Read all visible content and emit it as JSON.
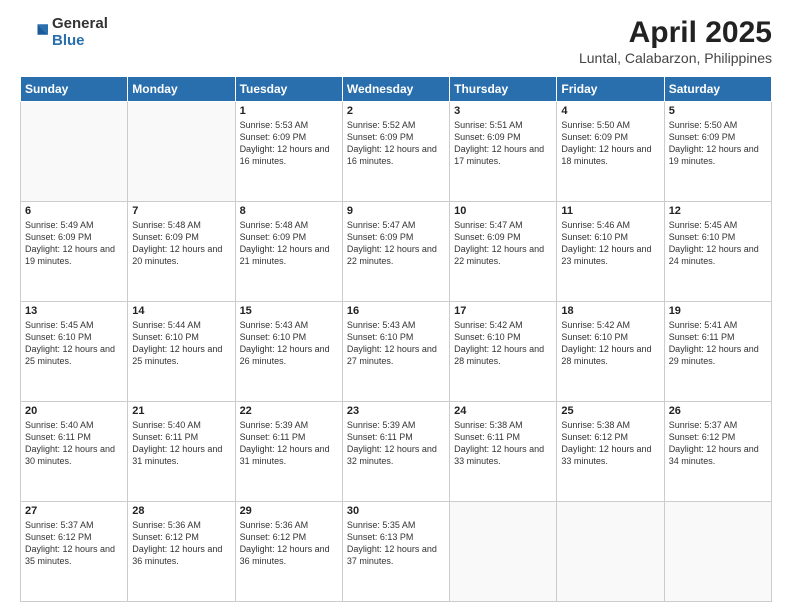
{
  "header": {
    "logo_general": "General",
    "logo_blue": "Blue",
    "month_title": "April 2025",
    "location": "Luntal, Calabarzon, Philippines"
  },
  "weekdays": [
    "Sunday",
    "Monday",
    "Tuesday",
    "Wednesday",
    "Thursday",
    "Friday",
    "Saturday"
  ],
  "weeks": [
    [
      {
        "day": "",
        "sunrise": "",
        "sunset": "",
        "daylight": "",
        "empty": true
      },
      {
        "day": "",
        "sunrise": "",
        "sunset": "",
        "daylight": "",
        "empty": true
      },
      {
        "day": "1",
        "sunrise": "Sunrise: 5:53 AM",
        "sunset": "Sunset: 6:09 PM",
        "daylight": "Daylight: 12 hours and 16 minutes.",
        "empty": false
      },
      {
        "day": "2",
        "sunrise": "Sunrise: 5:52 AM",
        "sunset": "Sunset: 6:09 PM",
        "daylight": "Daylight: 12 hours and 16 minutes.",
        "empty": false
      },
      {
        "day": "3",
        "sunrise": "Sunrise: 5:51 AM",
        "sunset": "Sunset: 6:09 PM",
        "daylight": "Daylight: 12 hours and 17 minutes.",
        "empty": false
      },
      {
        "day": "4",
        "sunrise": "Sunrise: 5:50 AM",
        "sunset": "Sunset: 6:09 PM",
        "daylight": "Daylight: 12 hours and 18 minutes.",
        "empty": false
      },
      {
        "day": "5",
        "sunrise": "Sunrise: 5:50 AM",
        "sunset": "Sunset: 6:09 PM",
        "daylight": "Daylight: 12 hours and 19 minutes.",
        "empty": false
      }
    ],
    [
      {
        "day": "6",
        "sunrise": "Sunrise: 5:49 AM",
        "sunset": "Sunset: 6:09 PM",
        "daylight": "Daylight: 12 hours and 19 minutes.",
        "empty": false
      },
      {
        "day": "7",
        "sunrise": "Sunrise: 5:48 AM",
        "sunset": "Sunset: 6:09 PM",
        "daylight": "Daylight: 12 hours and 20 minutes.",
        "empty": false
      },
      {
        "day": "8",
        "sunrise": "Sunrise: 5:48 AM",
        "sunset": "Sunset: 6:09 PM",
        "daylight": "Daylight: 12 hours and 21 minutes.",
        "empty": false
      },
      {
        "day": "9",
        "sunrise": "Sunrise: 5:47 AM",
        "sunset": "Sunset: 6:09 PM",
        "daylight": "Daylight: 12 hours and 22 minutes.",
        "empty": false
      },
      {
        "day": "10",
        "sunrise": "Sunrise: 5:47 AM",
        "sunset": "Sunset: 6:09 PM",
        "daylight": "Daylight: 12 hours and 22 minutes.",
        "empty": false
      },
      {
        "day": "11",
        "sunrise": "Sunrise: 5:46 AM",
        "sunset": "Sunset: 6:10 PM",
        "daylight": "Daylight: 12 hours and 23 minutes.",
        "empty": false
      },
      {
        "day": "12",
        "sunrise": "Sunrise: 5:45 AM",
        "sunset": "Sunset: 6:10 PM",
        "daylight": "Daylight: 12 hours and 24 minutes.",
        "empty": false
      }
    ],
    [
      {
        "day": "13",
        "sunrise": "Sunrise: 5:45 AM",
        "sunset": "Sunset: 6:10 PM",
        "daylight": "Daylight: 12 hours and 25 minutes.",
        "empty": false
      },
      {
        "day": "14",
        "sunrise": "Sunrise: 5:44 AM",
        "sunset": "Sunset: 6:10 PM",
        "daylight": "Daylight: 12 hours and 25 minutes.",
        "empty": false
      },
      {
        "day": "15",
        "sunrise": "Sunrise: 5:43 AM",
        "sunset": "Sunset: 6:10 PM",
        "daylight": "Daylight: 12 hours and 26 minutes.",
        "empty": false
      },
      {
        "day": "16",
        "sunrise": "Sunrise: 5:43 AM",
        "sunset": "Sunset: 6:10 PM",
        "daylight": "Daylight: 12 hours and 27 minutes.",
        "empty": false
      },
      {
        "day": "17",
        "sunrise": "Sunrise: 5:42 AM",
        "sunset": "Sunset: 6:10 PM",
        "daylight": "Daylight: 12 hours and 28 minutes.",
        "empty": false
      },
      {
        "day": "18",
        "sunrise": "Sunrise: 5:42 AM",
        "sunset": "Sunset: 6:10 PM",
        "daylight": "Daylight: 12 hours and 28 minutes.",
        "empty": false
      },
      {
        "day": "19",
        "sunrise": "Sunrise: 5:41 AM",
        "sunset": "Sunset: 6:11 PM",
        "daylight": "Daylight: 12 hours and 29 minutes.",
        "empty": false
      }
    ],
    [
      {
        "day": "20",
        "sunrise": "Sunrise: 5:40 AM",
        "sunset": "Sunset: 6:11 PM",
        "daylight": "Daylight: 12 hours and 30 minutes.",
        "empty": false
      },
      {
        "day": "21",
        "sunrise": "Sunrise: 5:40 AM",
        "sunset": "Sunset: 6:11 PM",
        "daylight": "Daylight: 12 hours and 31 minutes.",
        "empty": false
      },
      {
        "day": "22",
        "sunrise": "Sunrise: 5:39 AM",
        "sunset": "Sunset: 6:11 PM",
        "daylight": "Daylight: 12 hours and 31 minutes.",
        "empty": false
      },
      {
        "day": "23",
        "sunrise": "Sunrise: 5:39 AM",
        "sunset": "Sunset: 6:11 PM",
        "daylight": "Daylight: 12 hours and 32 minutes.",
        "empty": false
      },
      {
        "day": "24",
        "sunrise": "Sunrise: 5:38 AM",
        "sunset": "Sunset: 6:11 PM",
        "daylight": "Daylight: 12 hours and 33 minutes.",
        "empty": false
      },
      {
        "day": "25",
        "sunrise": "Sunrise: 5:38 AM",
        "sunset": "Sunset: 6:12 PM",
        "daylight": "Daylight: 12 hours and 33 minutes.",
        "empty": false
      },
      {
        "day": "26",
        "sunrise": "Sunrise: 5:37 AM",
        "sunset": "Sunset: 6:12 PM",
        "daylight": "Daylight: 12 hours and 34 minutes.",
        "empty": false
      }
    ],
    [
      {
        "day": "27",
        "sunrise": "Sunrise: 5:37 AM",
        "sunset": "Sunset: 6:12 PM",
        "daylight": "Daylight: 12 hours and 35 minutes.",
        "empty": false
      },
      {
        "day": "28",
        "sunrise": "Sunrise: 5:36 AM",
        "sunset": "Sunset: 6:12 PM",
        "daylight": "Daylight: 12 hours and 36 minutes.",
        "empty": false
      },
      {
        "day": "29",
        "sunrise": "Sunrise: 5:36 AM",
        "sunset": "Sunset: 6:12 PM",
        "daylight": "Daylight: 12 hours and 36 minutes.",
        "empty": false
      },
      {
        "day": "30",
        "sunrise": "Sunrise: 5:35 AM",
        "sunset": "Sunset: 6:13 PM",
        "daylight": "Daylight: 12 hours and 37 minutes.",
        "empty": false
      },
      {
        "day": "",
        "sunrise": "",
        "sunset": "",
        "daylight": "",
        "empty": true
      },
      {
        "day": "",
        "sunrise": "",
        "sunset": "",
        "daylight": "",
        "empty": true
      },
      {
        "day": "",
        "sunrise": "",
        "sunset": "",
        "daylight": "",
        "empty": true
      }
    ]
  ]
}
